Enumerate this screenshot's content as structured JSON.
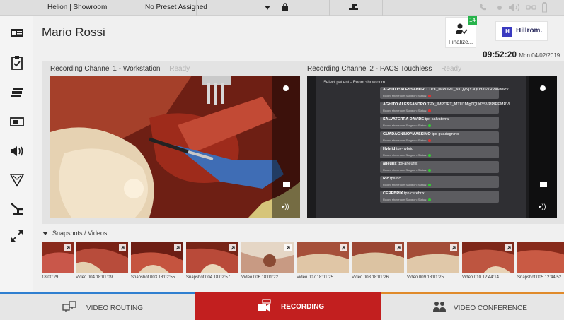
{
  "topbar": {
    "site": "Helion | Showroom",
    "preset": "No Preset Assigned",
    "icons": [
      "lock-icon",
      "chevron-down-icon",
      "operating-table-icon",
      "phone-icon",
      "record-dot-icon",
      "speaker-icon",
      "glasses-icon",
      "battery-icon"
    ]
  },
  "sidebar": {
    "items": [
      {
        "icon": "patient-card-icon"
      },
      {
        "icon": "clipboard-check-icon"
      },
      {
        "icon": "stack-layers-icon"
      },
      {
        "icon": "display-screens-icon"
      },
      {
        "icon": "volume-icon"
      },
      {
        "icon": "ceiling-light-icon"
      },
      {
        "icon": "surgical-table-icon"
      },
      {
        "icon": "expand-icon"
      }
    ]
  },
  "patient": {
    "name": "Mario Rossi"
  },
  "finalize": {
    "badge": "14",
    "label": "Finalize..."
  },
  "brand": {
    "mark": "H",
    "name": "Hillrom."
  },
  "clock": {
    "time": "09:52:20",
    "date": "Mon 04/02/2019"
  },
  "channels": [
    {
      "title": "Recording Channel 1 - Workstation",
      "status": "Ready"
    },
    {
      "title": "Recording Channel 2 - PACS Touchless",
      "status": "Ready"
    }
  ],
  "pacs": {
    "header": "Select patient - Room showroom",
    "rows": [
      {
        "name": "AGHITO^ALESSANDRO",
        "id": "TPX_IMPORT_NTQyNjY3QUd3SVRPXPMRV",
        "meta": "Room: showroom  Surgeon:  Status:",
        "status": "#d33"
      },
      {
        "name": "AGHITO ALESSANDRO",
        "id": "TPX_IMPORT_MTU1Mjg0QUd3SVRPIEPMRVI",
        "meta": "Room: showroom  Surgeon:  Status:",
        "status": "#d33"
      },
      {
        "name": "SALVATERRA DAVIDE",
        "id": "tpx-salvaterra",
        "meta": "Room: showroom  Surgeon:  Status:",
        "status": "#3c3"
      },
      {
        "name": "GUADAGNINO^MASSIMO",
        "id": "tpx-guadagnino",
        "meta": "Room: showroom  Surgeon:  Status:",
        "status": "#d33"
      },
      {
        "name": "Hybrid",
        "id": "tpx-hybrid",
        "meta": "Room: showroom  Surgeon:  Status:",
        "status": "#3c3"
      },
      {
        "name": "aneurix",
        "id": "tpx-aneurix",
        "meta": "Room: showroom  Surgeon:  Status:",
        "status": "#3c3"
      },
      {
        "name": "Ric",
        "id": "tpx-ric",
        "meta": "Room: showroom  Surgeon:  Status:",
        "status": "#3c3"
      },
      {
        "name": "CEREBRIX",
        "id": "tpx-cerebrix",
        "meta": "Room: showroom  Surgeon:  Status:",
        "status": "#3c3"
      }
    ]
  },
  "snapshots": {
    "header": "Snapshots / Videos",
    "items": [
      {
        "caption": "18:00:29"
      },
      {
        "caption": "Video 004 18:01:09"
      },
      {
        "caption": "Snapshot 003 18:02:55"
      },
      {
        "caption": "Snapshot 004 18:02:57"
      },
      {
        "caption": "Video 006 18:01:22"
      },
      {
        "caption": "Video 007 18:01:25"
      },
      {
        "caption": "Video 008 18:01:26"
      },
      {
        "caption": "Video 009 18:01:25"
      },
      {
        "caption": "Video 010 12:44:14"
      },
      {
        "caption": "Snapshot 005 12:44:52"
      }
    ]
  },
  "tabs": [
    {
      "label": "VIDEO ROUTING",
      "active": false
    },
    {
      "label": "RECORDING",
      "active": true
    },
    {
      "label": "VIDEO CONFERENCE",
      "active": false
    }
  ],
  "colors": {
    "accent_active": "#c21f1f",
    "tab_inactive": "#e6e6e6",
    "left_accent": "#2f7fd0",
    "right_accent": "#e08a2a"
  }
}
